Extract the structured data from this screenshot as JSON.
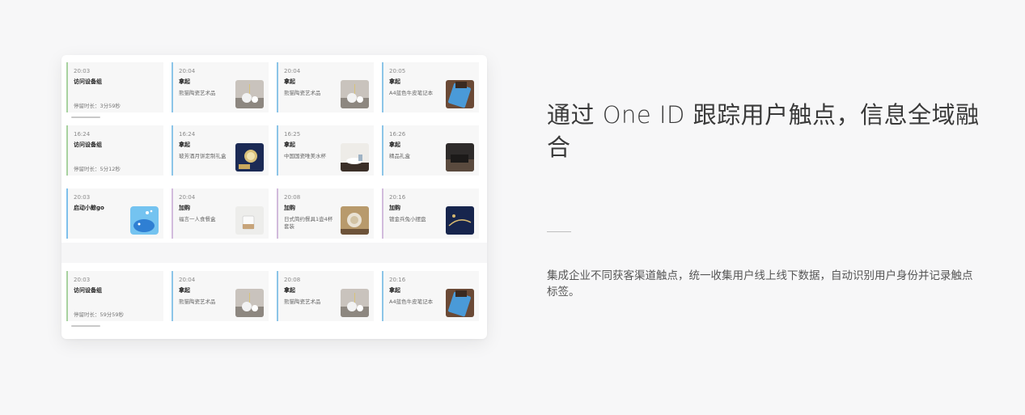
{
  "headline": "通过 One ID 跟踪用户触点，信息全域融合",
  "description": "集成企业不同获客渠道触点，统一收集用户线上线下数据，自动识别用户身份并记录触点标签。",
  "rows": [
    [
      {
        "time": "20:03",
        "action": "访问设备组",
        "product": "",
        "duration": "停留时长：3分59秒",
        "accent": "#a8d2a0"
      },
      {
        "time": "20:04",
        "action": "拿起",
        "product": "熊猫陶瓷艺术品",
        "duration": "",
        "accent": "#8cc5e8",
        "image": "panda-ceramic-image"
      },
      {
        "time": "20:04",
        "action": "拿起",
        "product": "熊猫陶瓷艺术品",
        "duration": "",
        "accent": "#8cc5e8",
        "image": "panda-ceramic-image"
      },
      {
        "time": "20:05",
        "action": "拿起",
        "product": "A4蓝色牛皮笔记本",
        "duration": "",
        "accent": "#8cc5e8",
        "image": "notebook-image"
      }
    ],
    [
      {
        "time": "16:24",
        "action": "访问设备组",
        "product": "",
        "duration": "停留时长：5分12秒",
        "accent": "#a8d2a0"
      },
      {
        "time": "16:24",
        "action": "拿起",
        "product": "玻芳酒月饼定制礼盒",
        "duration": "",
        "accent": "#8cc5e8",
        "image": "mooncake-box-image"
      },
      {
        "time": "16:25",
        "action": "拿起",
        "product": "中国国瓷唯美水杯",
        "duration": "",
        "accent": "#8cc5e8",
        "image": "teacup-image"
      },
      {
        "time": "16:26",
        "action": "拿起",
        "product": "精品礼盒",
        "duration": "",
        "accent": "#8cc5e8",
        "image": "gift-box-image"
      }
    ],
    [
      {
        "time": "20:03",
        "action": "启动小鲸go",
        "product": "",
        "duration": "",
        "accent": "#8cc5e8",
        "image": "whale-app-icon"
      },
      {
        "time": "20:04",
        "action": "加购",
        "product": "福言一人食餐盒",
        "duration": "",
        "accent": "#d2bbdc",
        "image": "lunch-box-image"
      },
      {
        "time": "20:08",
        "action": "加购",
        "product": "日式简约餐具1壶4杯套装",
        "duration": "",
        "accent": "#d2bbdc",
        "image": "tea-set-image"
      },
      {
        "time": "20:16",
        "action": "加购",
        "product": "镀金兵兔小摆盘",
        "duration": "",
        "accent": "#d2bbdc",
        "image": "gold-plate-image"
      }
    ],
    [
      {
        "time": "20:03",
        "action": "访问设备组",
        "product": "",
        "duration": "停留时长：59分59秒",
        "accent": "#a8d2a0"
      },
      {
        "time": "20:04",
        "action": "拿起",
        "product": "熊猫陶瓷艺术品",
        "duration": "",
        "accent": "#8cc5e8",
        "image": "panda-ceramic-image"
      },
      {
        "time": "20:08",
        "action": "拿起",
        "product": "熊猫陶瓷艺术品",
        "duration": "",
        "accent": "#8cc5e8",
        "image": "panda-ceramic-image"
      },
      {
        "time": "20:16",
        "action": "拿起",
        "product": "A4蓝色牛皮笔记本",
        "duration": "",
        "accent": "#8cc5e8",
        "image": "notebook-image"
      }
    ]
  ]
}
